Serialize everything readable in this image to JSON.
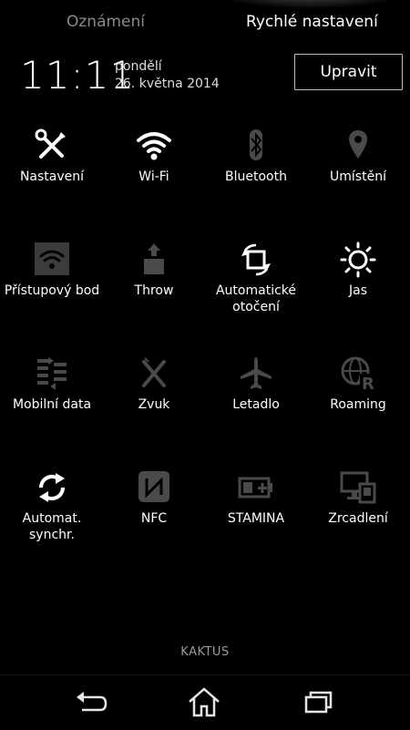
{
  "tabs": {
    "notifications": "Oznámení",
    "quick_settings": "Rychlé nastavení"
  },
  "status": {
    "time": "11:11",
    "day": "pondělí",
    "date": "26. května 2014"
  },
  "edit_label": "Upravit",
  "tiles": [
    {
      "label": "Nastavení",
      "icon": "tools-icon",
      "active": true
    },
    {
      "label": "Wi-Fi",
      "icon": "wifi-icon",
      "active": true
    },
    {
      "label": "Bluetooth",
      "icon": "bluetooth-icon",
      "active": false
    },
    {
      "label": "Umístění",
      "icon": "location-icon",
      "active": false
    },
    {
      "label": "Přístupový bod",
      "icon": "hotspot-icon",
      "active": false
    },
    {
      "label": "Throw",
      "icon": "throw-icon",
      "active": false
    },
    {
      "label": "Automatické otočení",
      "icon": "auto-rotate-icon",
      "active": true
    },
    {
      "label": "Jas",
      "icon": "brightness-icon",
      "active": true
    },
    {
      "label": "Mobilní data",
      "icon": "mobile-data-icon",
      "active": false
    },
    {
      "label": "Zvuk",
      "icon": "sound-muted-icon",
      "active": false
    },
    {
      "label": "Letadlo",
      "icon": "airplane-icon",
      "active": false
    },
    {
      "label": "Roaming",
      "icon": "roaming-icon",
      "active": false
    },
    {
      "label": "Automat. synchr.",
      "icon": "sync-icon",
      "active": true
    },
    {
      "label": "NFC",
      "icon": "nfc-icon",
      "active": false
    },
    {
      "label": "STAMINA",
      "icon": "battery-stamina-icon",
      "active": false
    },
    {
      "label": "Zrcadlení",
      "icon": "screen-mirror-icon",
      "active": false
    }
  ],
  "carrier": "KAKTUS",
  "colors": {
    "active": "#ffffff",
    "inactive": "#5a5a5a",
    "background": "#000000"
  }
}
